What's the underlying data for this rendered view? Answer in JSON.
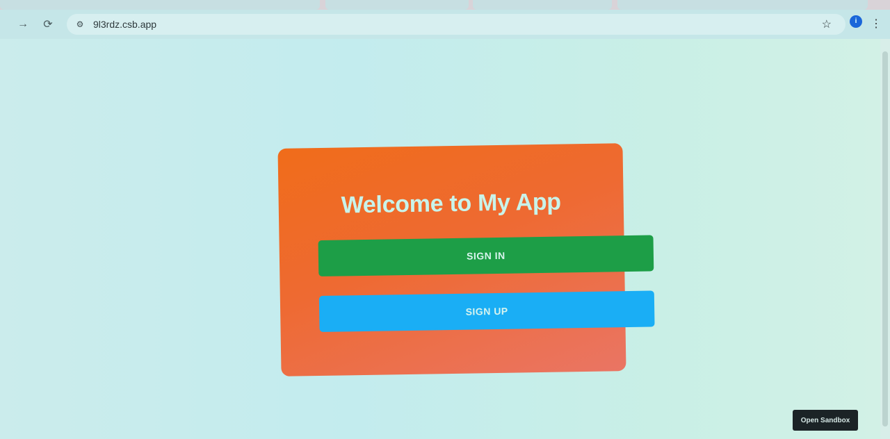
{
  "browser": {
    "url": "9l3rdz.csb.app",
    "forward_icon": "arrow-right-icon",
    "reload_icon": "reload-icon",
    "site_info_icon": "tune-icon",
    "bookmark_icon": "star-icon",
    "menu_icon": "kebab-menu-icon",
    "profile_icon": "profile-icon"
  },
  "app": {
    "title": "Welcome to My App",
    "signin_label": "SIGN IN",
    "signup_label": "SIGN UP",
    "card_colors": {
      "from": "#f06c1a",
      "to": "#ea7564"
    },
    "signin_color": "#1d9e47",
    "signup_color": "#1aaef5"
  },
  "sandbox": {
    "open_label": "Open Sandbox"
  }
}
